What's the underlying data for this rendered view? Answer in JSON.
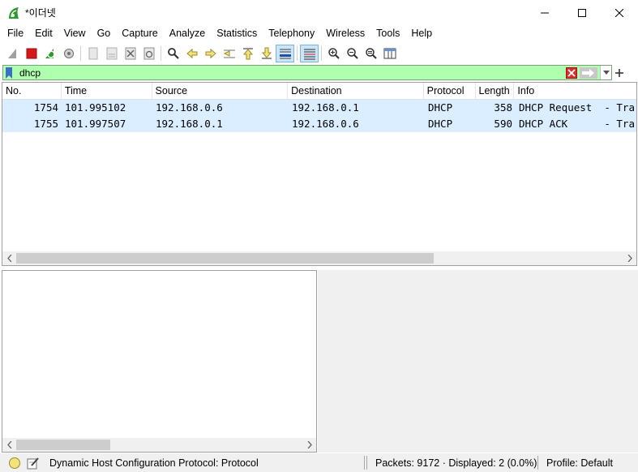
{
  "window": {
    "title": "*이더넷"
  },
  "menu": {
    "items": [
      "File",
      "Edit",
      "View",
      "Go",
      "Capture",
      "Analyze",
      "Statistics",
      "Telephony",
      "Wireless",
      "Tools",
      "Help"
    ]
  },
  "filter": {
    "value": "dhcp",
    "background_color": "#afffaf"
  },
  "packet_list": {
    "columns": [
      "No.",
      "Time",
      "Source",
      "Destination",
      "Protocol",
      "Length",
      "Info"
    ],
    "rows": [
      {
        "no": "1754",
        "time": "101.995102",
        "source": "192.168.0.6",
        "destination": "192.168.0.1",
        "protocol": "DHCP",
        "length": "358",
        "info": "DHCP Request  - Tra"
      },
      {
        "no": "1755",
        "time": "101.997507",
        "source": "192.168.0.1",
        "destination": "192.168.0.6",
        "protocol": "DHCP",
        "length": "590",
        "info": "DHCP ACK      - Tra"
      }
    ],
    "row_color": "#daeeff"
  },
  "status": {
    "field_text": "Dynamic Host Configuration Protocol: Protocol",
    "packets_text": "Packets: 9172 · Displayed: 2 (0.0%)",
    "profile_text": "Profile: Default"
  }
}
